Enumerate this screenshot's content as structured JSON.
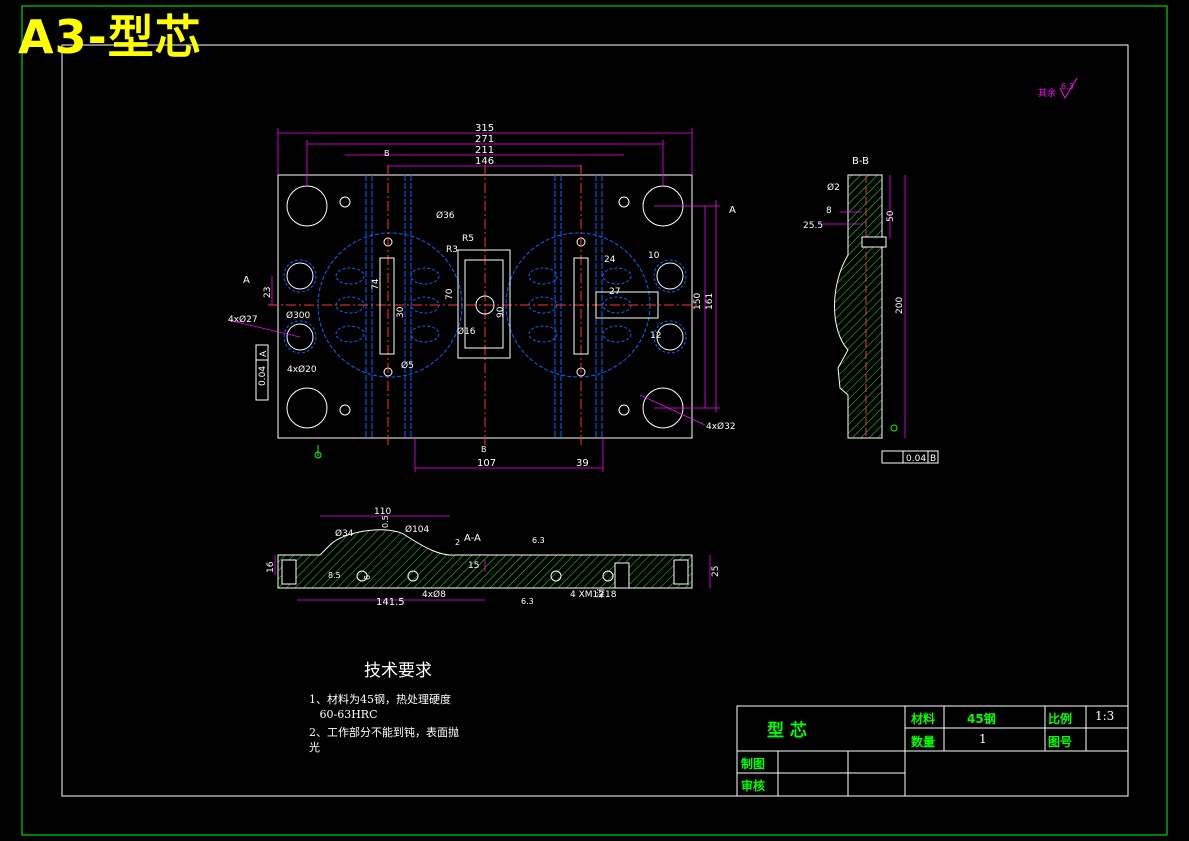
{
  "title": "A3-型芯",
  "roughness_note": {
    "label": "其余",
    "value": "6.3"
  },
  "front_view": {
    "dims_top": [
      "315",
      "271",
      "211",
      "146"
    ],
    "dims_bottom": [
      "107",
      "39"
    ],
    "dims_right": [
      "24",
      "10",
      "27",
      "12",
      "150",
      "161"
    ],
    "dims_left": [
      "23"
    ],
    "labels": {
      "phi36": "Ø36",
      "r5": "R5",
      "r3": "R3",
      "n74": "74",
      "n70": "70",
      "n30": "30",
      "n90": "90",
      "phi16": "Ø16",
      "phi300": "Ø300",
      "phi5": "Ø5",
      "hole_a": "4xØ27",
      "hole_b": "4xØ20",
      "hole_c": "4xØ32",
      "section_a": "A",
      "section_b": "B"
    },
    "tolerance_frame": [
      "0.04",
      "A"
    ]
  },
  "section_bb": {
    "title": "B-B",
    "labels": {
      "phi2": "Ø2",
      "n8": "8",
      "n255": "25.5",
      "n50": "50",
      "n200": "200"
    },
    "tolerance_frame": [
      "0.04",
      "B"
    ]
  },
  "section_aa": {
    "title": "A-A",
    "labels": {
      "n110": "110",
      "phi34": "Ø34",
      "phi104": "Ø104",
      "n05": "0.5",
      "n16": "16",
      "n6": "6",
      "n15": "15",
      "n25": "25",
      "n1415": "141.5",
      "phi8": "4xØ8",
      "m12": "4 XM12",
      "depth": "深18",
      "ra1": "6.3",
      "ra2": "6.3",
      "n2": "2"
    }
  },
  "tech_requirements": {
    "heading": "技术要求",
    "lines": [
      "1、材料为45钢，热处理硬度",
      "   60-63HRC",
      "2、工作部分不能到钝，表面抛",
      "光"
    ]
  },
  "title_block": {
    "part_name": "型  芯",
    "material_label": "材料",
    "material_value": "45钢",
    "scale_label": "比例",
    "scale_value": "1:3",
    "qty_label": "数量",
    "qty_value": "1",
    "drawing_no_label": "图号",
    "drawn_label": "制图",
    "checked_label": "审核"
  }
}
